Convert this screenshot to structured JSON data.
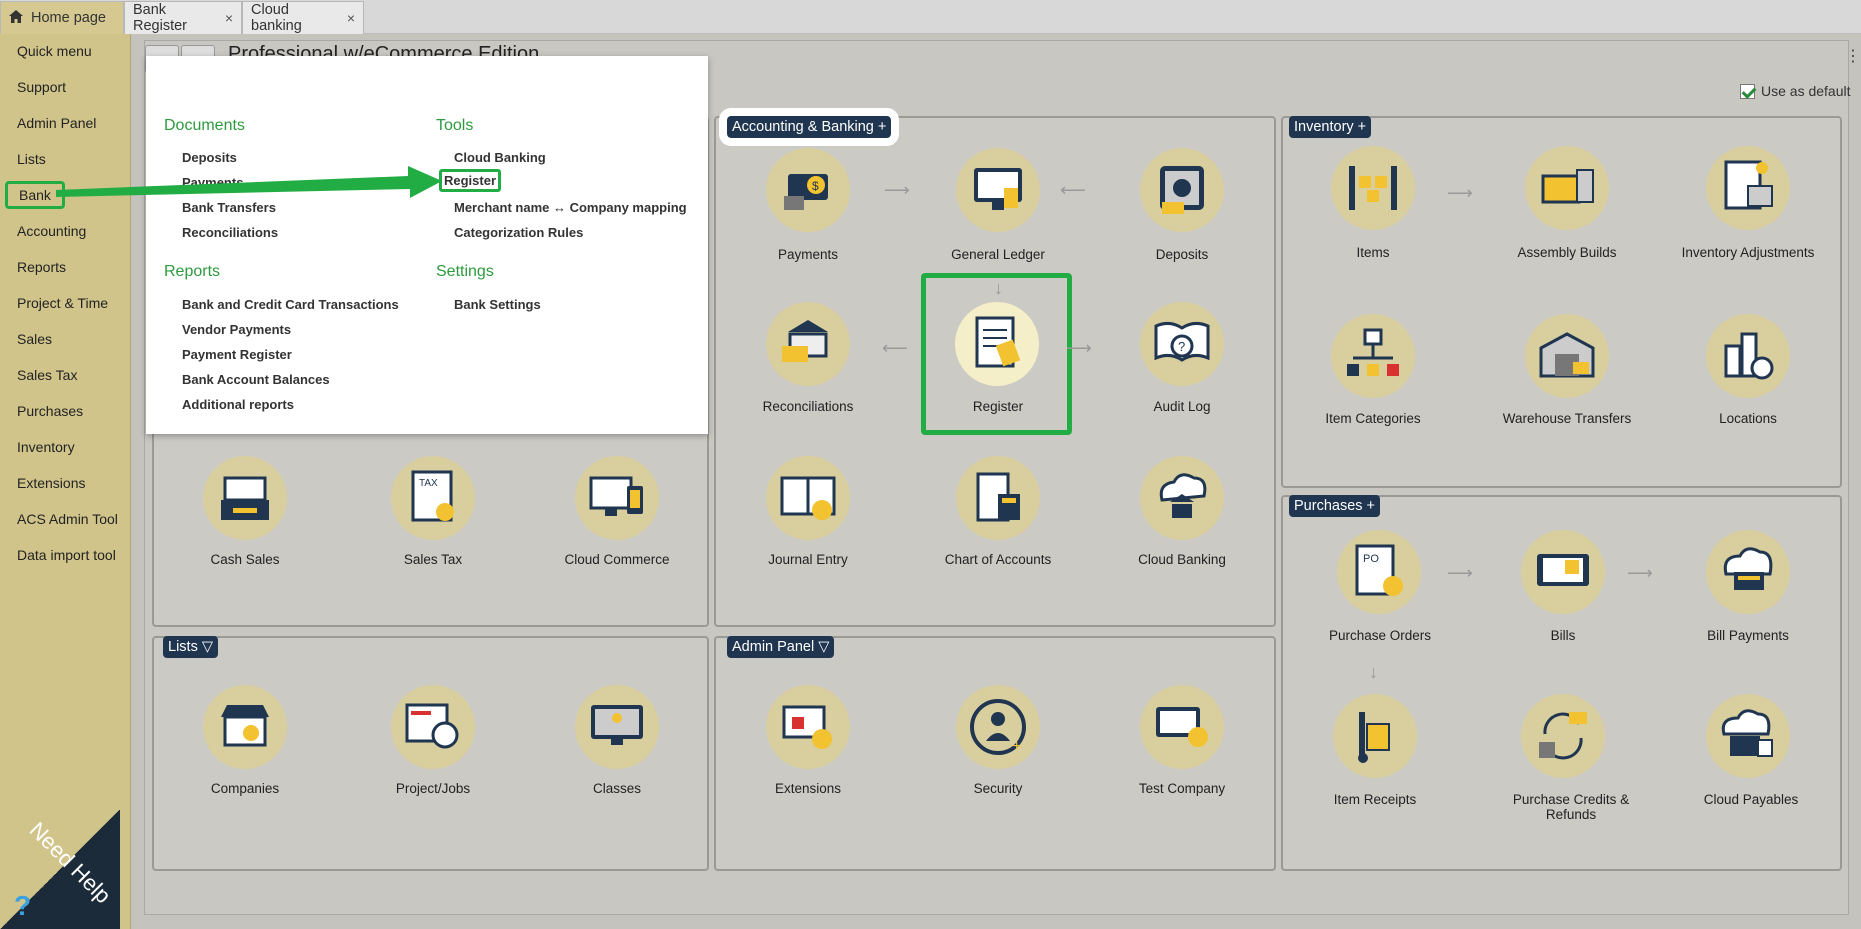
{
  "tabs": [
    {
      "label": "Home page"
    },
    {
      "label": "Bank Register"
    },
    {
      "label": "Cloud banking"
    }
  ],
  "sidebar": {
    "items": [
      "Quick menu",
      "Support",
      "Admin Panel",
      "Lists",
      "Bank",
      "Accounting",
      "Reports",
      "Project & Time",
      "Sales",
      "Sales Tax",
      "Purchases",
      "Inventory",
      "Extensions",
      "ACS Admin Tool",
      "Data import tool"
    ]
  },
  "header": {
    "edition": "Professional w/eCommerce Edition",
    "use_default": "Use as default"
  },
  "need_help": "Need Help",
  "menu": {
    "documents_heading": "Documents",
    "documents": [
      "Deposits",
      "Payments",
      "Bank Transfers",
      "Reconciliations"
    ],
    "tools_heading": "Tools",
    "tools": [
      "Cloud Banking",
      "Register",
      "Merchant name ↔ Company mapping",
      "Categorization Rules"
    ],
    "reports_heading": "Reports",
    "reports": [
      "Bank and Credit Card Transactions",
      "Vendor Payments",
      "Payment Register",
      "Bank Account Balances",
      "Additional reports"
    ],
    "settings_heading": "Settings",
    "settings": [
      "Bank Settings"
    ]
  },
  "panels": {
    "accounting": {
      "title": "Accounting & Banking +",
      "items": [
        "Payments",
        "General Ledger",
        "Deposits",
        "Reconciliations",
        "Register",
        "Audit Log",
        "Journal Entry",
        "Chart of Accounts",
        "Cloud Banking"
      ]
    },
    "inventory": {
      "title": "Inventory +",
      "items": [
        "Items",
        "Assembly Builds",
        "Inventory Adjustments",
        "Item Categories",
        "Warehouse Transfers",
        "Locations"
      ]
    },
    "purchases": {
      "title": "Purchases +",
      "items": [
        "Purchase Orders",
        "Bills",
        "Bill Payments",
        "Item Receipts",
        "Purchase Credits & Refunds",
        "Cloud Payables"
      ]
    },
    "sales": {
      "items": [
        "Cash Sales",
        "Sales Tax",
        "Cloud Commerce"
      ]
    },
    "lists": {
      "title": "Lists ▽",
      "items": [
        "Companies",
        "Project/Jobs",
        "Classes"
      ]
    },
    "admin": {
      "title": "Admin Panel ▽",
      "items": [
        "Extensions",
        "Security",
        "Test Company"
      ]
    }
  },
  "colors": {
    "accent": "#22ad44",
    "sidebar": "#d1c48b",
    "title_bg": "#1f3550",
    "heading": "#2e9a3e"
  }
}
